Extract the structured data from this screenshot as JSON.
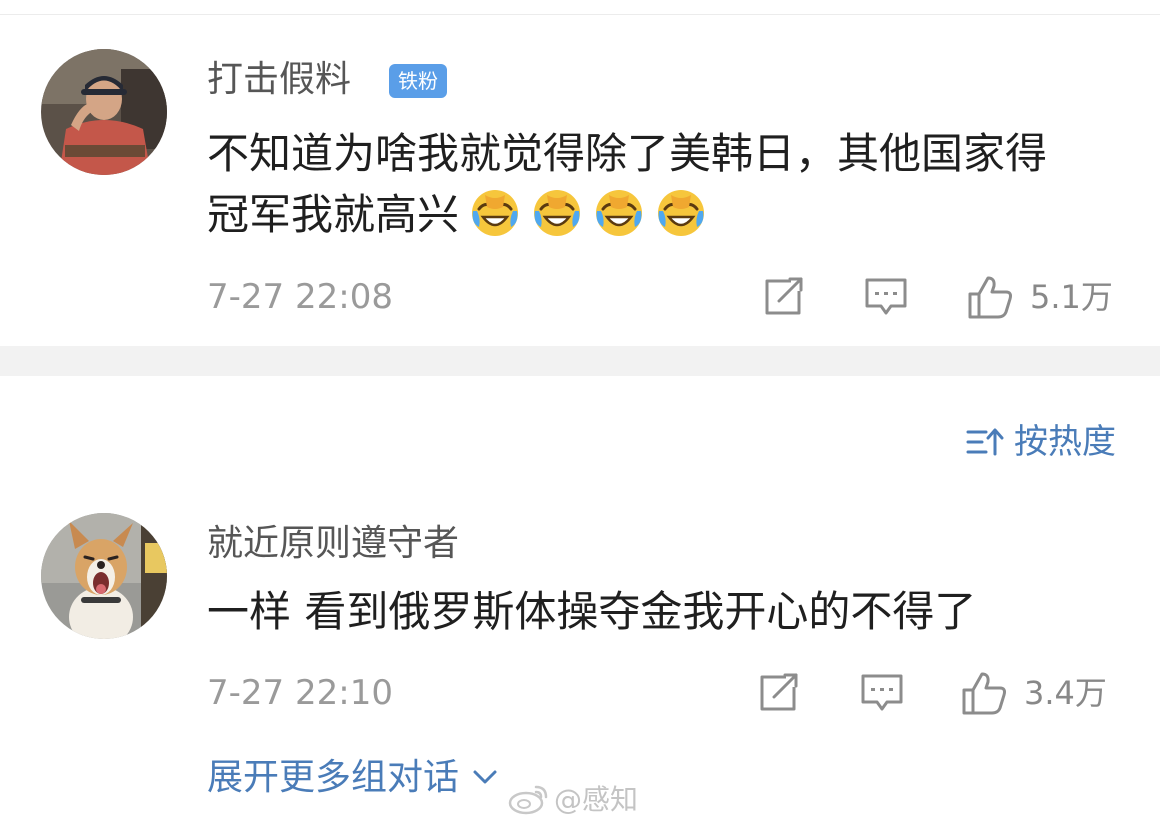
{
  "comments": [
    {
      "username": "打击假料",
      "badge": "铁粉",
      "text_line1": "不知道为啥我就觉得除了美韩日，其他国家得",
      "text_line2": "冠军我就高兴",
      "emoji_count": 4,
      "timestamp": "7-27 22:08",
      "likes": "5.1万"
    },
    {
      "username": "就近原则遵守者",
      "text": "一样 看到俄罗斯体操夺金我开心的不得了",
      "timestamp": "7-27 22:10",
      "likes": "3.4万"
    }
  ],
  "sort": {
    "label": "按热度"
  },
  "expand": {
    "label": "展开更多组对话"
  },
  "watermark": {
    "text": "@感知"
  },
  "icons": {
    "share": "share-icon",
    "reply": "reply-icon",
    "like": "thumbs-up-icon",
    "sort": "sort-icon",
    "expand": "chevron-down-icon",
    "emoji": "laughing-crying-emoji"
  },
  "colors": {
    "link_blue": "#4a7cb8",
    "badge_blue": "#5a9ee8",
    "emoji_yellow": "#f6c63c",
    "tear_blue": "#4fa8f0"
  }
}
